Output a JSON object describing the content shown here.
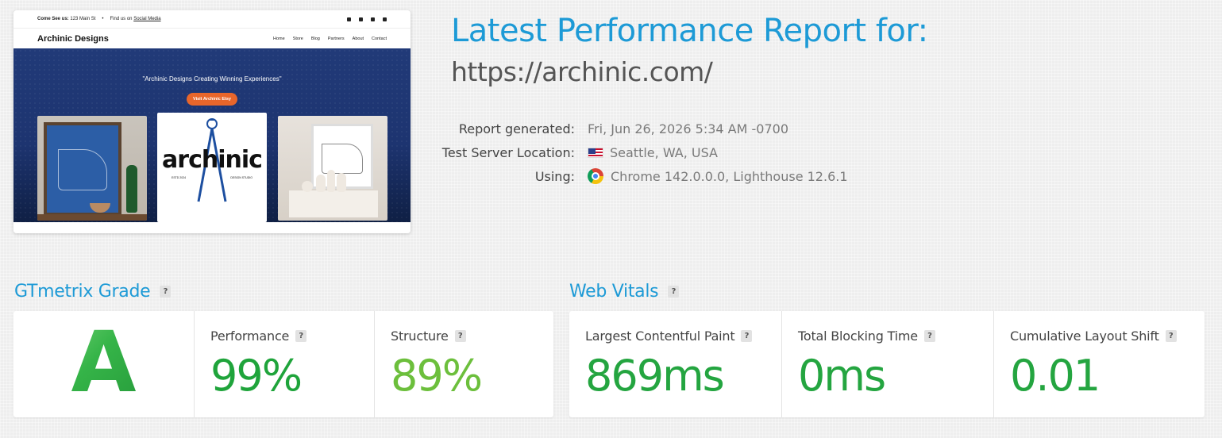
{
  "thumbnail": {
    "topbar_come_see": "Come See us:",
    "topbar_address": "123 Main St",
    "topbar_find": "Find us on",
    "topbar_social": "Social Media",
    "brand": "Archinic Designs",
    "nav": [
      "Home",
      "Store",
      "Blog",
      "Partners",
      "About",
      "Contact"
    ],
    "headline": "\"Archinic Designs Creating Winning Experiences\"",
    "cta": "Visit Archinic Etsy",
    "logo_word": "archinic",
    "logo_left": "ESTD 2024",
    "logo_right": "DESIGN STUDIO"
  },
  "report": {
    "title": "Latest Performance Report for:",
    "url": "https://archinic.com/",
    "meta": {
      "generated_label": "Report generated:",
      "generated_value": "Fri, Jun 26, 2026 5:34 AM -0700",
      "location_label": "Test Server Location:",
      "location_value": "Seattle, WA, USA",
      "using_label": "Using:",
      "using_value": "Chrome 142.0.0.0, Lighthouse 12.6.1"
    }
  },
  "grade": {
    "heading": "GTmetrix Grade",
    "help": "?",
    "letter": "A",
    "performance_label": "Performance",
    "performance_value": "99%",
    "structure_label": "Structure",
    "structure_value": "89%"
  },
  "vitals": {
    "heading": "Web Vitals",
    "help": "?",
    "lcp_label": "Largest Contentful Paint",
    "lcp_value": "869ms",
    "tbt_label": "Total Blocking Time",
    "tbt_value": "0ms",
    "cls_label": "Cumulative Layout Shift",
    "cls_value": "0.01"
  },
  "colors": {
    "accent": "#1d9ad6",
    "grade_green": "#2eb14a",
    "performance": "#1fa43b",
    "structure": "#6cbf3c",
    "vitals": "#24a540"
  }
}
